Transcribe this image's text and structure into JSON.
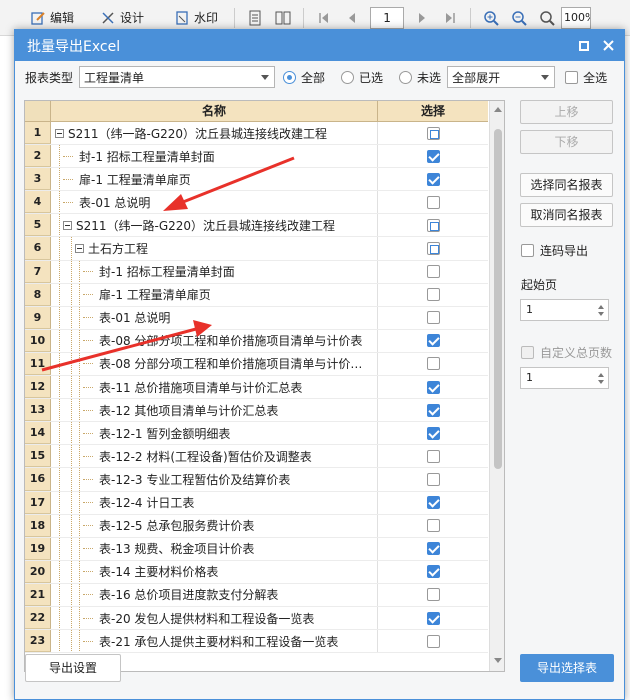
{
  "toolbar": {
    "edit_label": "编辑",
    "design_label": "设计",
    "watermark_label": "水印",
    "page_value": "1",
    "zoom_value": "100%"
  },
  "dialog": {
    "title": "批量导出Excel",
    "report_type_label": "报表类型",
    "report_type_value": "工程量清单",
    "radio_all": "全部",
    "radio_selected": "已选",
    "radio_unselected": "未选",
    "expand_value": "全部展开",
    "select_all_label": "全选",
    "header_name": "名称",
    "header_select": "选择",
    "rows": [
      {
        "num": "1",
        "name": "S211（纬一路-G220）沈丘县城连接线改建工程",
        "level": 0,
        "toggle": true,
        "state": "part"
      },
      {
        "num": "2",
        "name": "封-1 招标工程量清单封面",
        "level": 1,
        "toggle": false,
        "state": "on"
      },
      {
        "num": "3",
        "name": "扉-1 工程量清单扉页",
        "level": 1,
        "toggle": false,
        "state": "on"
      },
      {
        "num": "4",
        "name": "表-01 总说明",
        "level": 1,
        "toggle": false,
        "state": "off"
      },
      {
        "num": "5",
        "name": "S211（纬一路-G220）沈丘县城连接线改建工程",
        "level": 1,
        "toggle": true,
        "state": "part"
      },
      {
        "num": "6",
        "name": "土石方工程",
        "level": 2,
        "toggle": true,
        "state": "part"
      },
      {
        "num": "7",
        "name": "封-1 招标工程量清单封面",
        "level": 3,
        "toggle": false,
        "state": "off"
      },
      {
        "num": "8",
        "name": "扉-1 工程量清单扉页",
        "level": 3,
        "toggle": false,
        "state": "off"
      },
      {
        "num": "9",
        "name": "表-01 总说明",
        "level": 3,
        "toggle": false,
        "state": "off"
      },
      {
        "num": "10",
        "name": "表-08 分部分项工程和单价措施项目清单与计价表",
        "level": 3,
        "toggle": false,
        "state": "on"
      },
      {
        "num": "11",
        "name": "表-08 分部分项工程和单价措施项目清单与计价…",
        "level": 3,
        "toggle": false,
        "state": "off"
      },
      {
        "num": "12",
        "name": "表-11 总价措施项目清单与计价汇总表",
        "level": 3,
        "toggle": false,
        "state": "on"
      },
      {
        "num": "13",
        "name": "表-12 其他项目清单与计价汇总表",
        "level": 3,
        "toggle": false,
        "state": "on"
      },
      {
        "num": "14",
        "name": "表-12-1 暂列金额明细表",
        "level": 3,
        "toggle": false,
        "state": "on"
      },
      {
        "num": "15",
        "name": "表-12-2 材料(工程设备)暂估价及调整表",
        "level": 3,
        "toggle": false,
        "state": "off"
      },
      {
        "num": "16",
        "name": "表-12-3 专业工程暂估价及结算价表",
        "level": 3,
        "toggle": false,
        "state": "off"
      },
      {
        "num": "17",
        "name": "表-12-4 计日工表",
        "level": 3,
        "toggle": false,
        "state": "on"
      },
      {
        "num": "18",
        "name": "表-12-5 总承包服务费计价表",
        "level": 3,
        "toggle": false,
        "state": "off"
      },
      {
        "num": "19",
        "name": "表-13 规费、税金项目计价表",
        "level": 3,
        "toggle": false,
        "state": "on"
      },
      {
        "num": "20",
        "name": "表-14 主要材料价格表",
        "level": 3,
        "toggle": false,
        "state": "on"
      },
      {
        "num": "21",
        "name": "表-16 总价项目进度款支付分解表",
        "level": 3,
        "toggle": false,
        "state": "off"
      },
      {
        "num": "22",
        "name": "表-20 发包人提供材料和工程设备一览表",
        "level": 3,
        "toggle": false,
        "state": "on"
      },
      {
        "num": "23",
        "name": "表-21 承包人提供主要材料和工程设备一览表",
        "level": 3,
        "toggle": false,
        "state": "off"
      }
    ],
    "move_up": "上移",
    "move_down": "下移",
    "select_same": "选择同名报表",
    "cancel_same": "取消同名报表",
    "continuous_label": "连码导出",
    "start_page_label": "起始页",
    "start_page_value": "1",
    "custom_total_label": "自定义总页数",
    "custom_total_value": "1",
    "export_settings": "导出设置",
    "export_selected": "导出选择表"
  },
  "colors": {
    "accent": "#4a90d9",
    "header_bg": "#f4e3bf",
    "annotation_arrow": "#e8312a"
  }
}
